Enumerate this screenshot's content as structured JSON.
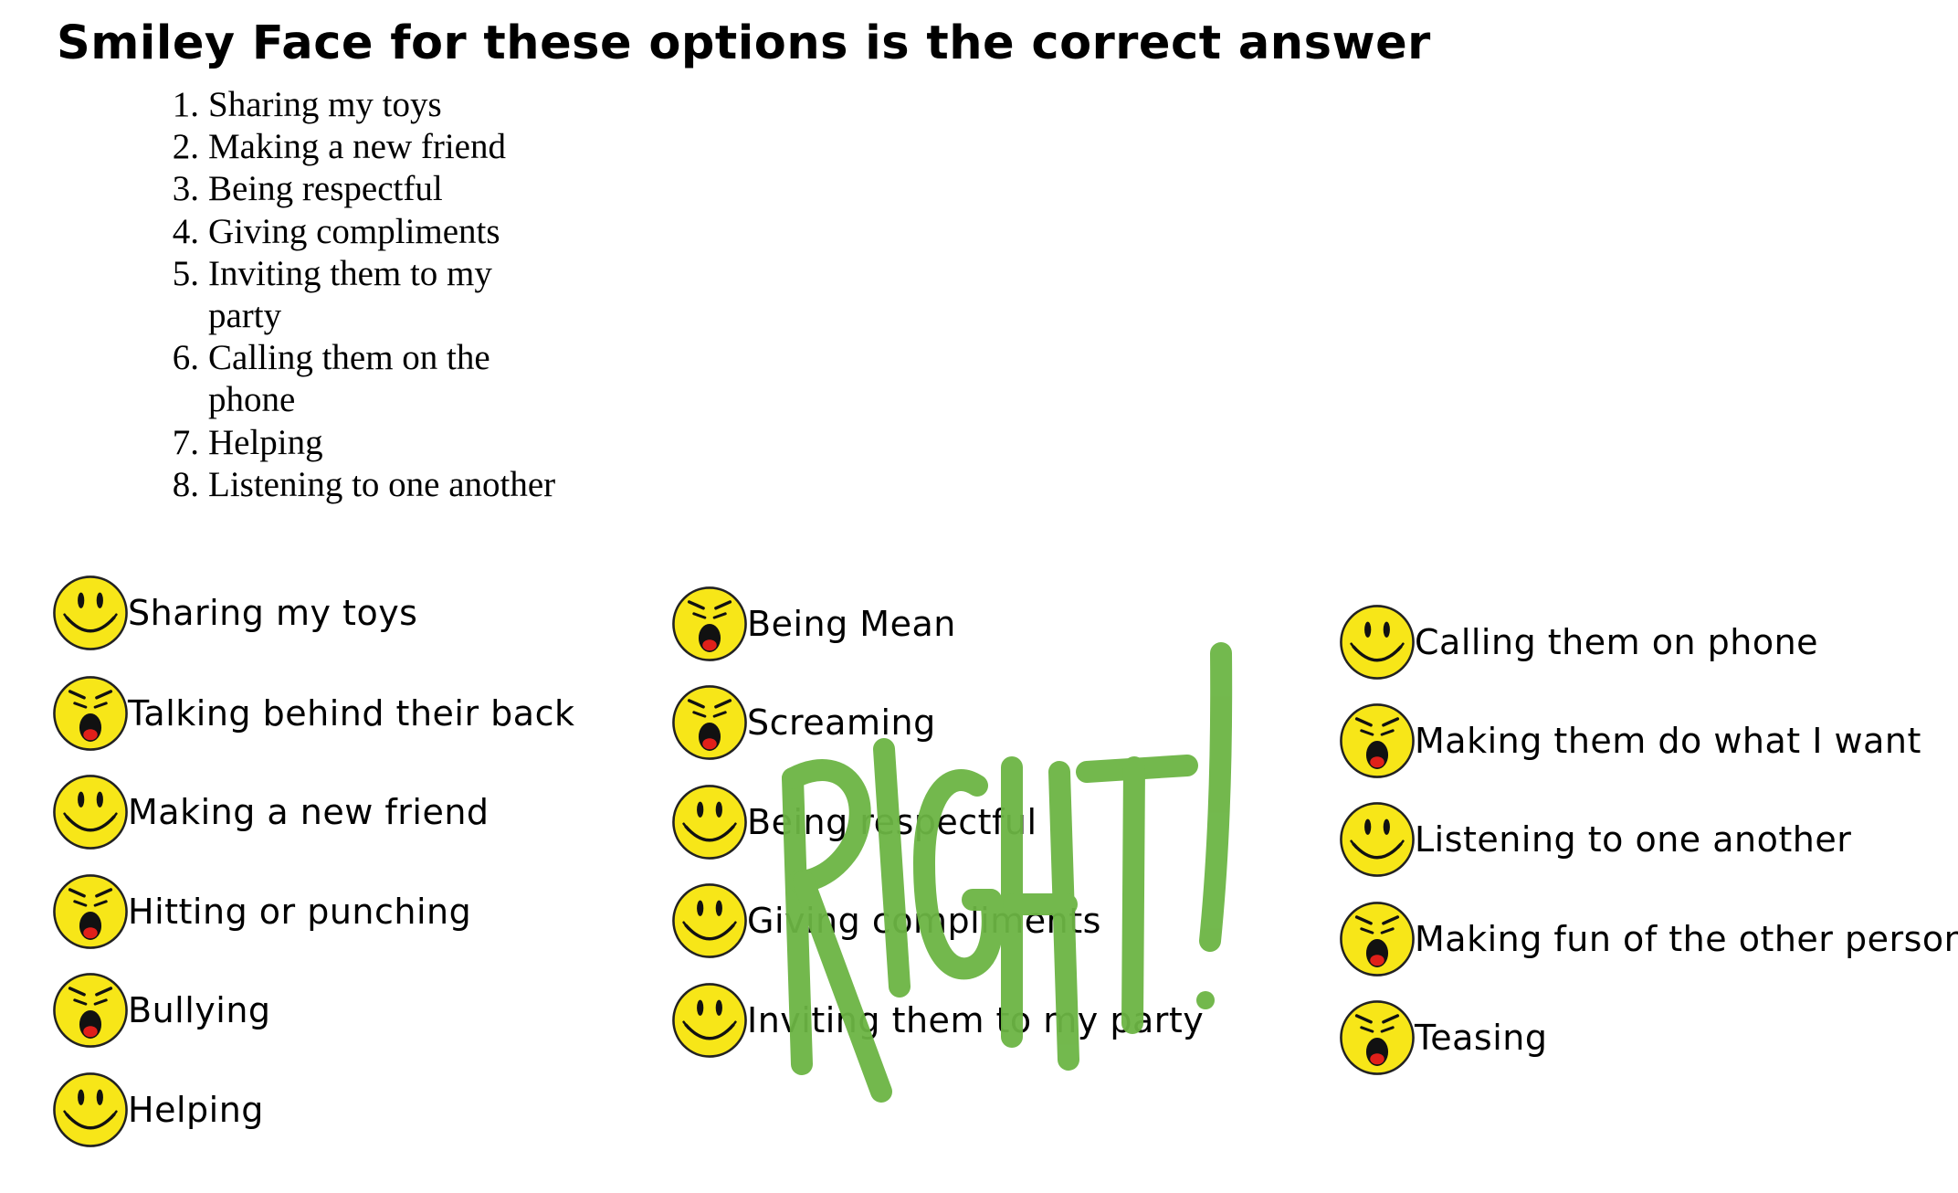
{
  "title": "Smiley Face for these options is the correct answer",
  "answers": [
    {
      "num": "1.",
      "text": "Sharing my toys"
    },
    {
      "num": "2.",
      "text": "Making a new friend"
    },
    {
      "num": "3.",
      "text": "Being respectful"
    },
    {
      "num": "4.",
      "text": "Giving compliments"
    },
    {
      "num": "5.",
      "text": "Inviting them to my party"
    },
    {
      "num": "6.",
      "text": "Calling them on the phone"
    },
    {
      "num": "7.",
      "text": "Helping"
    },
    {
      "num": "8.",
      "text": "Listening to one another"
    }
  ],
  "options": {
    "col1": [
      {
        "text": "Sharing my toys",
        "icon": "happy-face-icon"
      },
      {
        "text": "Talking behind their back",
        "icon": "angry-face-icon"
      },
      {
        "text": "Making a new friend",
        "icon": "happy-face-icon"
      },
      {
        "text": "Hitting or punching",
        "icon": "angry-face-icon"
      },
      {
        "text": "Bullying",
        "icon": "angry-face-icon"
      },
      {
        "text": "Helping",
        "icon": "happy-face-icon"
      }
    ],
    "col2": [
      {
        "text": "Being Mean",
        "icon": "angry-face-icon"
      },
      {
        "text": "Screaming",
        "icon": "angry-face-icon"
      },
      {
        "text": "Being respectful",
        "icon": "happy-face-icon"
      },
      {
        "text": "Giving compliments",
        "icon": "happy-face-icon"
      },
      {
        "text": "Inviting them to my party",
        "icon": "happy-face-icon"
      }
    ],
    "col3": [
      {
        "text": "Calling them on phone",
        "icon": "happy-face-icon"
      },
      {
        "text": "Making them do what I want",
        "icon": "angry-face-icon"
      },
      {
        "text": "Listening to one another",
        "icon": "happy-face-icon"
      },
      {
        "text": "Making fun of the other person",
        "icon": "angry-face-icon"
      },
      {
        "text": "Teasing",
        "icon": "angry-face-icon"
      }
    ]
  },
  "stamp": {
    "text": "RIGHT!",
    "color": "#6cb544"
  },
  "colors": {
    "face": "#f7e618",
    "face_outline": "#222222",
    "mouth_red": "#e0201a"
  }
}
